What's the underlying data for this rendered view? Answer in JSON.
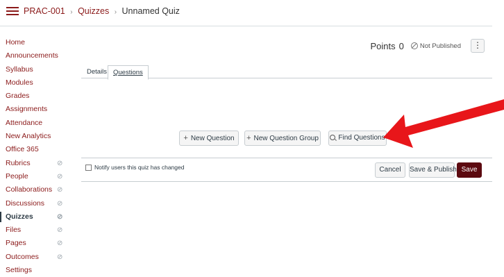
{
  "breadcrumb": {
    "course": "PRAC-001",
    "section": "Quizzes",
    "current": "Unnamed Quiz",
    "separator": "›"
  },
  "sidebar": {
    "items": [
      {
        "label": "Home",
        "hidden_icon": false
      },
      {
        "label": "Announcements",
        "hidden_icon": false
      },
      {
        "label": "Syllabus",
        "hidden_icon": false
      },
      {
        "label": "Modules",
        "hidden_icon": false
      },
      {
        "label": "Grades",
        "hidden_icon": false
      },
      {
        "label": "Assignments",
        "hidden_icon": false
      },
      {
        "label": "Attendance",
        "hidden_icon": false
      },
      {
        "label": "New Analytics",
        "hidden_icon": false
      },
      {
        "label": "Office 365",
        "hidden_icon": false
      },
      {
        "label": "Rubrics",
        "hidden_icon": true
      },
      {
        "label": "People",
        "hidden_icon": true
      },
      {
        "label": "Collaborations",
        "hidden_icon": true
      },
      {
        "label": "Discussions",
        "hidden_icon": true
      },
      {
        "label": "Quizzes",
        "hidden_icon": true,
        "active": true
      },
      {
        "label": "Files",
        "hidden_icon": true
      },
      {
        "label": "Pages",
        "hidden_icon": true
      },
      {
        "label": "Outcomes",
        "hidden_icon": true
      },
      {
        "label": "Settings",
        "hidden_icon": false
      }
    ],
    "hidden_icon_glyph": "⊘"
  },
  "header": {
    "points_label": "Points",
    "points_value": "0",
    "publish_status": "Not Published",
    "kebab": "⋮"
  },
  "tabs": [
    {
      "label": "Details"
    },
    {
      "label": "Questions"
    }
  ],
  "questions": {
    "new_question_label": "New Question",
    "new_group_label": "New Question Group",
    "find_questions_label": "Find Questions",
    "plus_glyph": "+"
  },
  "footer": {
    "notify_label": "Notify users this quiz has changed",
    "cancel_label": "Cancel",
    "save_publish_label": "Save & Publish",
    "save_label": "Save"
  },
  "colors": {
    "brand": "#8b1a1a",
    "save_button": "#5c0a10",
    "annotation_arrow": "#e8161a"
  }
}
